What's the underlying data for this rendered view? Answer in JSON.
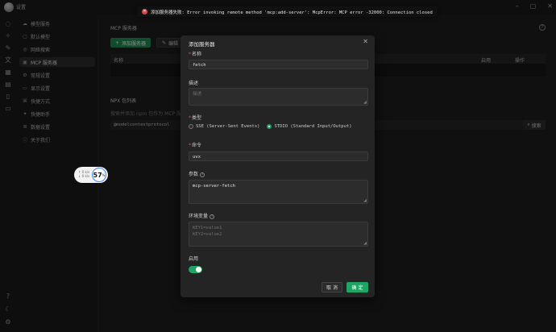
{
  "app": {
    "title": "设置"
  },
  "nav": {
    "items": [
      {
        "label": "模型服务",
        "icon": "cloud-icon",
        "glyph": "☁"
      },
      {
        "label": "默认模型",
        "icon": "box-icon",
        "glyph": "▢"
      },
      {
        "label": "网络搜索",
        "icon": "globe-icon",
        "glyph": "◎"
      },
      {
        "label": "MCP 服务器",
        "icon": "server-icon",
        "glyph": "▣"
      },
      {
        "label": "常规设置",
        "icon": "gear-icon",
        "glyph": "⚙"
      },
      {
        "label": "显示设置",
        "icon": "monitor-icon",
        "glyph": "▭"
      },
      {
        "label": "快捷方式",
        "icon": "command-icon",
        "glyph": "⌘"
      },
      {
        "label": "快捷助手",
        "icon": "rocket-icon",
        "glyph": "✦"
      },
      {
        "label": "数据设置",
        "icon": "database-icon",
        "glyph": "≣"
      },
      {
        "label": "关于我们",
        "icon": "info-icon",
        "glyph": "ⓘ"
      }
    ],
    "active_index": 3
  },
  "main": {
    "mcp_title": "MCP 服务器",
    "add_button": "添加服务器",
    "edit_button": "编辑",
    "columns": {
      "name": "名称",
      "enabled": "启用",
      "actions": "操作"
    },
    "npx_title": "NPX 包列表",
    "npx_desc": "搜索并添加 npm 包作为 MCP 服务",
    "npx_search_value": "@modelcontextprotocol",
    "npx_search_button": "搜索"
  },
  "toast": {
    "message": "添加服务器失败: Error invoking remote method 'mcp:add-server': McpError: MCP error -32000: Connection closed"
  },
  "zoom": {
    "line1": "↑ 0 k/s",
    "line2": "↓ 0 k/s",
    "value": "57",
    "unit": "%"
  },
  "modal": {
    "title": "添加服务器",
    "name_label": "名称",
    "name_value": "fetch",
    "desc_label": "描述",
    "desc_placeholder": "描述",
    "type_label": "类型",
    "type_options": [
      {
        "label": "SSE (Server-Sent Events)",
        "selected": false
      },
      {
        "label": "STDIO (Standard Input/Output)",
        "selected": true
      }
    ],
    "command_label": "命令",
    "command_value": "uvx",
    "args_label": "参数",
    "args_value": "mcp-server-fetch",
    "env_label": "环境变量",
    "env_placeholder": "KEY1=value1\nKEY2=value2",
    "enabled_label": "启用",
    "enabled": true,
    "cancel_button": "取 消",
    "ok_button": "确 定"
  },
  "colors": {
    "accent": "#1fa463",
    "error": "#e04343"
  }
}
